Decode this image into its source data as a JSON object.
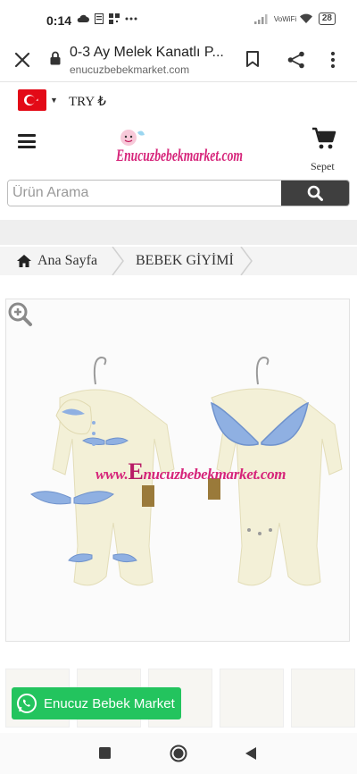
{
  "status_bar": {
    "time": "0:14",
    "network": "VoWiFi",
    "battery": "28"
  },
  "browser": {
    "page_title": "0-3 Ay Melek Kanatlı P...",
    "url": "enucuzbebekmarket.com"
  },
  "currency": {
    "code": "TRY ₺"
  },
  "header": {
    "logo_text": "Enucuzbebekmarket.com",
    "cart_label": "Sepet"
  },
  "search": {
    "placeholder": "Ürün Arama"
  },
  "breadcrumb": {
    "home": "Ana Sayfa",
    "category": "BEBEK GİYİMİ"
  },
  "product": {
    "watermark_text": "www.Enucuzbebekmarket.com"
  },
  "whatsapp": {
    "label": "Enucuz Bebek Market"
  },
  "colors": {
    "brand_pink": "#d6247a",
    "whatsapp_green": "#23c45e",
    "search_button": "#3f3f3f",
    "wing_blue": "#8fb0e2"
  }
}
